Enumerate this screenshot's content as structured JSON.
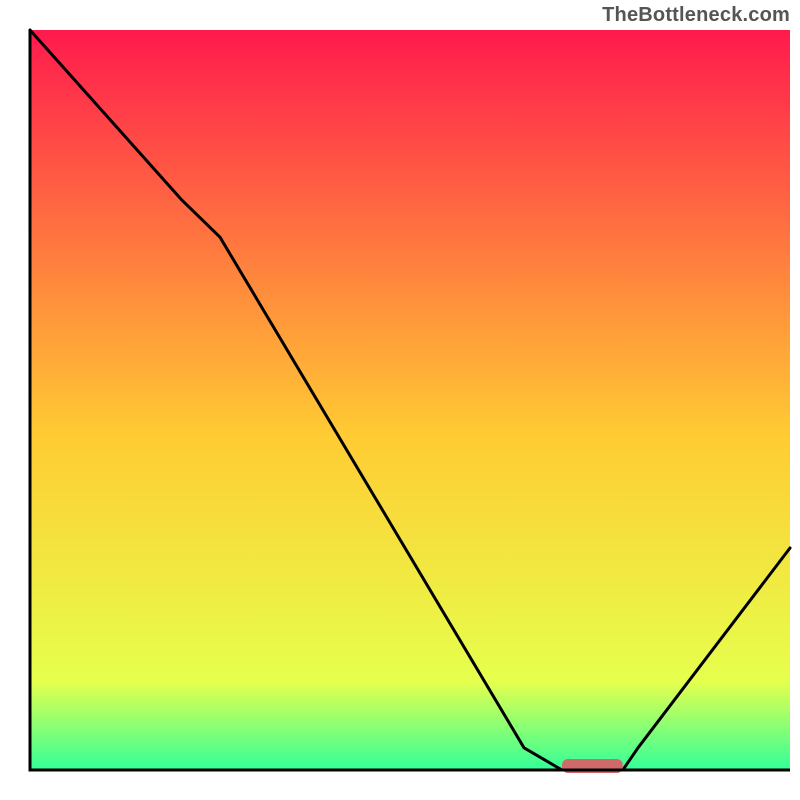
{
  "watermark": "TheBottleneck.com",
  "chart_data": {
    "type": "line",
    "title": "",
    "xlabel": "",
    "ylabel": "",
    "xlim": [
      0,
      100
    ],
    "ylim": [
      0,
      100
    ],
    "grid": false,
    "background_gradient": [
      "#ff1a4d",
      "#ffcc33",
      "#e6ff4d",
      "#33ff99"
    ],
    "series": [
      {
        "name": "bottleneck-curve",
        "color": "#000000",
        "x": [
          0,
          20,
          25,
          65,
          70,
          78,
          80,
          100
        ],
        "values": [
          100,
          77,
          72,
          3,
          0,
          0,
          3,
          30
        ]
      }
    ],
    "marker": {
      "name": "optimal-marker",
      "color": "#d06a6a",
      "x": 74,
      "y": 0,
      "width": 8,
      "height": 2
    },
    "axis_line_color": "#000000",
    "axis_line_width": 3
  }
}
